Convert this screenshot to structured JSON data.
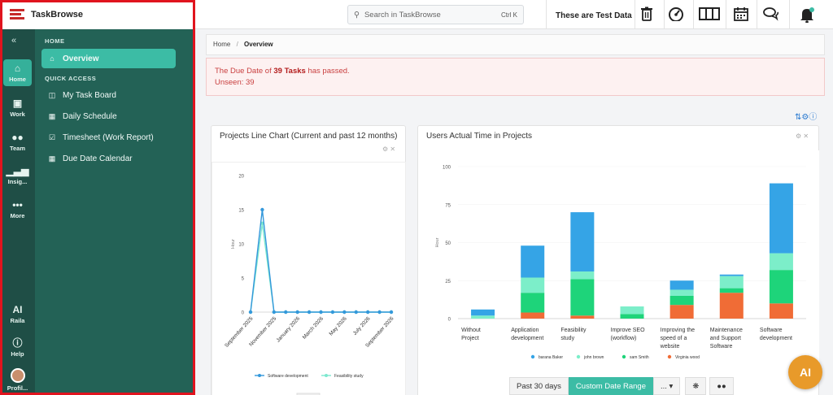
{
  "app": {
    "name": "TaskBrowse"
  },
  "rail": {
    "collapse_icon": "«",
    "items": [
      {
        "label": "Home",
        "icon": "home-icon"
      },
      {
        "label": "Work",
        "icon": "briefcase-icon"
      },
      {
        "label": "Team",
        "icon": "team-icon"
      },
      {
        "label": "Insig...",
        "icon": "bar-chart-icon"
      },
      {
        "label": "More",
        "icon": "more-icon"
      }
    ],
    "bottom": [
      {
        "label": "Raila",
        "icon": "ai-icon"
      },
      {
        "label": "Help",
        "icon": "help-icon"
      },
      {
        "label": "Profil...",
        "icon": "avatar"
      }
    ]
  },
  "panel": {
    "home_section": "HOME",
    "overview": "Overview",
    "quick_section": "QUICK ACCESS",
    "items": [
      "My Task Board",
      "Daily Schedule",
      "Timesheet (Work Report)",
      "Due Date Calendar"
    ]
  },
  "topbar": {
    "search_placeholder": "Search in TaskBrowse",
    "search_shortcut": "Ctrl K",
    "test_label": "These are Test Data",
    "icons": [
      "trash-icon",
      "dashboard-icon",
      "columns-icon",
      "calendar-icon",
      "chat-icon",
      "bell-icon"
    ]
  },
  "breadcrumb": {
    "home": "Home",
    "sep": "/",
    "current": "Overview"
  },
  "alert": {
    "prefix": "The Due Date of",
    "count": "39 Tasks",
    "suffix": "has passed.",
    "unseen": "Unseen: 39"
  },
  "line_card": {
    "title": "Projects Line Chart (Current and past 12 months)"
  },
  "bar_card": {
    "title": "Users Actual Time in Projects"
  },
  "range": {
    "past": "Past 30 days",
    "custom": "Custom Date Range",
    "more": "... ▾"
  },
  "colors": {
    "sidebar_dark": "#1f4e46",
    "sidebar": "#236256",
    "accent": "#3cbca5",
    "alert_text": "#c94040"
  },
  "chart_data": [
    {
      "type": "line",
      "title": "Projects Line Chart (Current and past 12 months)",
      "ylabel": "Hour",
      "ylim": [
        0,
        20
      ],
      "yticks": [
        0,
        5,
        10,
        15,
        20
      ],
      "x": [
        "September 2025",
        "October 2025",
        "November 2025",
        "December 2025",
        "January 2026",
        "February 2026",
        "March 2026",
        "April 2026",
        "May 2026",
        "June 2026",
        "July 2026",
        "August 2026",
        "September 2026"
      ],
      "xtick_labels": [
        "September 2025",
        "November 2025",
        "January 2026",
        "March 2026",
        "May 2026",
        "July 2026",
        "September 2026"
      ],
      "series": [
        {
          "name": "Software development",
          "color": "#3498db",
          "values": [
            0,
            15,
            0,
            0,
            0,
            0,
            0,
            0,
            0,
            0,
            0,
            0,
            0
          ]
        },
        {
          "name": "Feasibility study",
          "color": "#7de8cf",
          "values": [
            0,
            13,
            0,
            0,
            0,
            0,
            0,
            0,
            0,
            0,
            0,
            0,
            0
          ]
        }
      ],
      "legend": "bottom"
    },
    {
      "type": "bar",
      "stacked": true,
      "title": "Users Actual Time in Projects",
      "ylabel": "Hour",
      "ylim": [
        0,
        100
      ],
      "yticks": [
        0,
        25,
        50,
        75,
        100
      ],
      "categories": [
        "Without Project",
        "Application development",
        "Feasibility study",
        "Improve SEO (workflow)",
        "Improving the speed of a website",
        "Maintenance and Support Software",
        "Software development"
      ],
      "series": [
        {
          "name": "barana Baker",
          "color": "#35a4e6",
          "values": [
            4,
            21,
            39,
            0,
            6,
            1,
            46
          ]
        },
        {
          "name": "john brown",
          "color": "#7ceec9",
          "values": [
            2,
            10,
            5,
            5,
            4,
            8,
            11
          ]
        },
        {
          "name": "sam Smith",
          "color": "#1ed47a",
          "values": [
            0,
            13,
            24,
            3,
            6,
            3,
            22
          ]
        },
        {
          "name": "Virginia wood",
          "color": "#f06c36",
          "values": [
            0,
            4,
            2,
            0,
            9,
            17,
            10
          ]
        }
      ],
      "legend": "bottom"
    }
  ]
}
